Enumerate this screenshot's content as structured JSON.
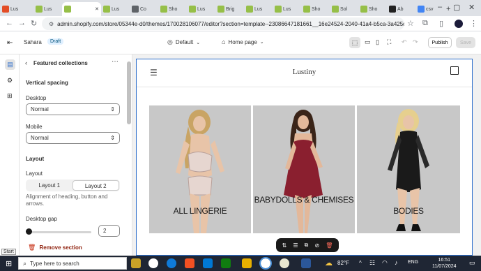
{
  "browser": {
    "tabs": [
      {
        "label": "Lus",
        "color": "#e34d26"
      },
      {
        "label": "Lus",
        "color": "#96bf48"
      },
      {
        "label": "",
        "color": "#96bf48",
        "active": true
      },
      {
        "label": "Lus",
        "color": "#96bf48"
      },
      {
        "label": "Co",
        "color": "#5f6368"
      },
      {
        "label": "Sho",
        "color": "#96bf48"
      },
      {
        "label": "Lus",
        "color": "#96bf48"
      },
      {
        "label": "Brig",
        "color": "#96bf48"
      },
      {
        "label": "Lus",
        "color": "#96bf48"
      },
      {
        "label": "Lus",
        "color": "#96bf48"
      },
      {
        "label": "Sho",
        "color": "#96bf48"
      },
      {
        "label": "Sol",
        "color": "#96bf48"
      },
      {
        "label": "Sho",
        "color": "#96bf48"
      },
      {
        "label": "Ab",
        "color": "#222222"
      },
      {
        "label": "csv",
        "color": "#4285f4"
      }
    ],
    "url": "admin.shopify.com/store/05344e-d0/themes/170028106077/editor?section=template--23086647181661__16e24524-2040-41a4-b5ca-3a425d628..."
  },
  "editor": {
    "store_name": "Sahara",
    "store_badge": "Draft",
    "theme_select": "Default",
    "page_select": "Home page",
    "publish_label": "Publish",
    "save_label": "Save"
  },
  "panel": {
    "title": "Featured collections",
    "vertical_spacing": "Vertical spacing",
    "desktop_label": "Desktop",
    "desktop_value": "Normal",
    "mobile_label": "Mobile",
    "mobile_value": "Normal",
    "layout_heading": "Layout",
    "layout_label": "Layout",
    "layout_opt1": "Layout 1",
    "layout_opt2": "Layout 2",
    "layout_help": "Alignment of heading, button and arrows.",
    "gap_label": "Desktop gap",
    "gap_value": "2",
    "remove_label": "Remove section"
  },
  "preview": {
    "brand": "Lustiny",
    "collections": [
      {
        "title": "ALL LINGERIE"
      },
      {
        "title": "BABYDOLLS & CHEMISES"
      },
      {
        "title": "BODIES"
      }
    ]
  },
  "taskbar": {
    "start_tip": "Start",
    "search_placeholder": "Type here to search",
    "weather": "82°F",
    "lang": "ENG",
    "time": "16:51",
    "date": "11/07/2024"
  }
}
